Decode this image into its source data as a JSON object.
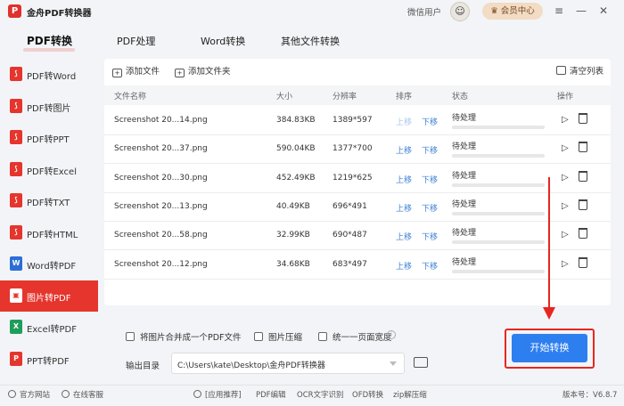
{
  "titlebar": {
    "logo": "P",
    "title": "金舟PDF转换器",
    "user": "微信用户",
    "avatar": "☺",
    "vip": "会员中心",
    "menu": "≡",
    "minimize": "—",
    "close": "✕"
  },
  "tabs": [
    "PDF转换",
    "PDF处理",
    "Word转换",
    "其他文件转换"
  ],
  "sidebar": [
    {
      "label": "PDF转Word",
      "icon": "pdf",
      "color": "#e5352d"
    },
    {
      "label": "PDF转图片",
      "icon": "pdf",
      "color": "#e5352d"
    },
    {
      "label": "PDF转PPT",
      "icon": "pdf",
      "color": "#e5352d"
    },
    {
      "label": "PDF转Excel",
      "icon": "pdf",
      "color": "#e5352d"
    },
    {
      "label": "PDF转TXT",
      "icon": "pdf",
      "color": "#e5352d"
    },
    {
      "label": "PDF转HTML",
      "icon": "pdf",
      "color": "#e5352d"
    },
    {
      "label": "Word转PDF",
      "icon": "W",
      "color": "#2b6fd6"
    },
    {
      "label": "图片转PDF",
      "icon": "img",
      "color": "#ffffff"
    },
    {
      "label": "Excel转PDF",
      "icon": "X",
      "color": "#1e9e5a"
    },
    {
      "label": "PPT转PDF",
      "icon": "P",
      "color": "#e5352d"
    }
  ],
  "toolbar": {
    "add_file": "添加文件",
    "add_folder": "添加文件夹",
    "clear_list": "清空列表"
  },
  "table": {
    "headers": {
      "name": "文件名称",
      "size": "大小",
      "resolution": "分辨率",
      "sort": "排序",
      "status": "状态",
      "action": "操作"
    },
    "up_label": "上移",
    "down_label": "下移",
    "rows": [
      {
        "name": "Screenshot 20...14.png",
        "size": "384.83KB",
        "resolution": "1389*597",
        "status": "待处理",
        "up_enabled": false,
        "progress": 0
      },
      {
        "name": "Screenshot 20...37.png",
        "size": "590.04KB",
        "resolution": "1377*700",
        "status": "待处理",
        "up_enabled": true,
        "progress": 0
      },
      {
        "name": "Screenshot 20...30.png",
        "size": "452.49KB",
        "resolution": "1219*625",
        "status": "待处理",
        "up_enabled": true,
        "progress": 0
      },
      {
        "name": "Screenshot 20...13.png",
        "size": "40.49KB",
        "resolution": "696*491",
        "status": "待处理",
        "up_enabled": true,
        "progress": 0
      },
      {
        "name": "Screenshot 20...58.png",
        "size": "32.99KB",
        "resolution": "690*487",
        "status": "待处理",
        "up_enabled": true,
        "progress": 0
      },
      {
        "name": "Screenshot 20...12.png",
        "size": "34.68KB",
        "resolution": "683*497",
        "status": "待处理",
        "up_enabled": true,
        "progress": 0
      }
    ]
  },
  "options": {
    "merge": "将图片合并成一个PDF文件",
    "compress": "图片压缩",
    "unify_width": "统一一页面宽度",
    "info": "i"
  },
  "output": {
    "label": "输出目录",
    "path": "C:\\Users\\kate\\Desktop\\金舟PDF转换器"
  },
  "start_button": "开始转换",
  "footer": {
    "website": "官方网站",
    "service": "在线客服",
    "promo": "[应用推荐]",
    "links": [
      "PDF编辑",
      "OCR文字识别",
      "OFD转换",
      "zip解压缩"
    ],
    "version_label": "版本号：",
    "version": "V6.8.7"
  },
  "colors": {
    "brand_red": "#e5352d",
    "accent_blue": "#2d7ff0",
    "annotation_red": "#e8261e"
  }
}
